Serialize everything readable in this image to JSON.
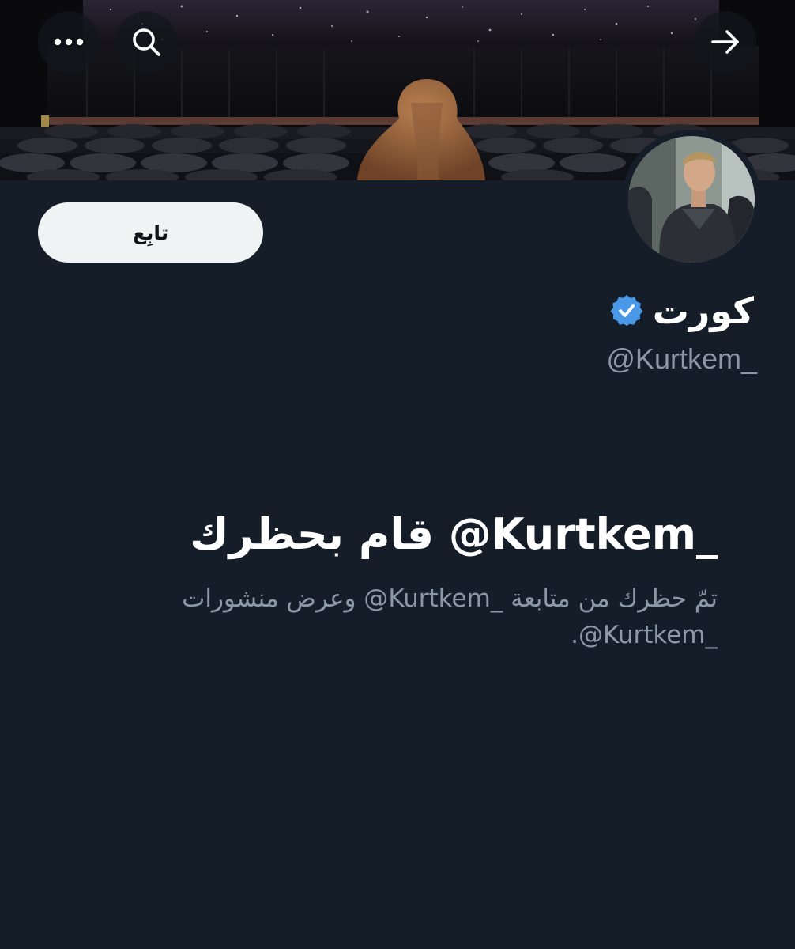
{
  "header": {
    "more_icon": "more-dots-icon",
    "search_icon": "search-icon",
    "back_icon": "arrow-right-icon"
  },
  "profile": {
    "display_name": "كورت",
    "verified": true,
    "verified_color": "#4a99e9",
    "handle": "@Kurtkem_",
    "follow_label": "تابِع"
  },
  "blocked": {
    "title": "_Kurtkem@ قام بحظرك",
    "description": "تمّ حظرك من متابعة _Kurtkem@ وعرض منشورات _Kurtkem@."
  },
  "colors": {
    "background": "#151d28",
    "primary_text": "#ffffff",
    "secondary_text": "#8b98a5",
    "button_bg": "#eff3f4"
  }
}
